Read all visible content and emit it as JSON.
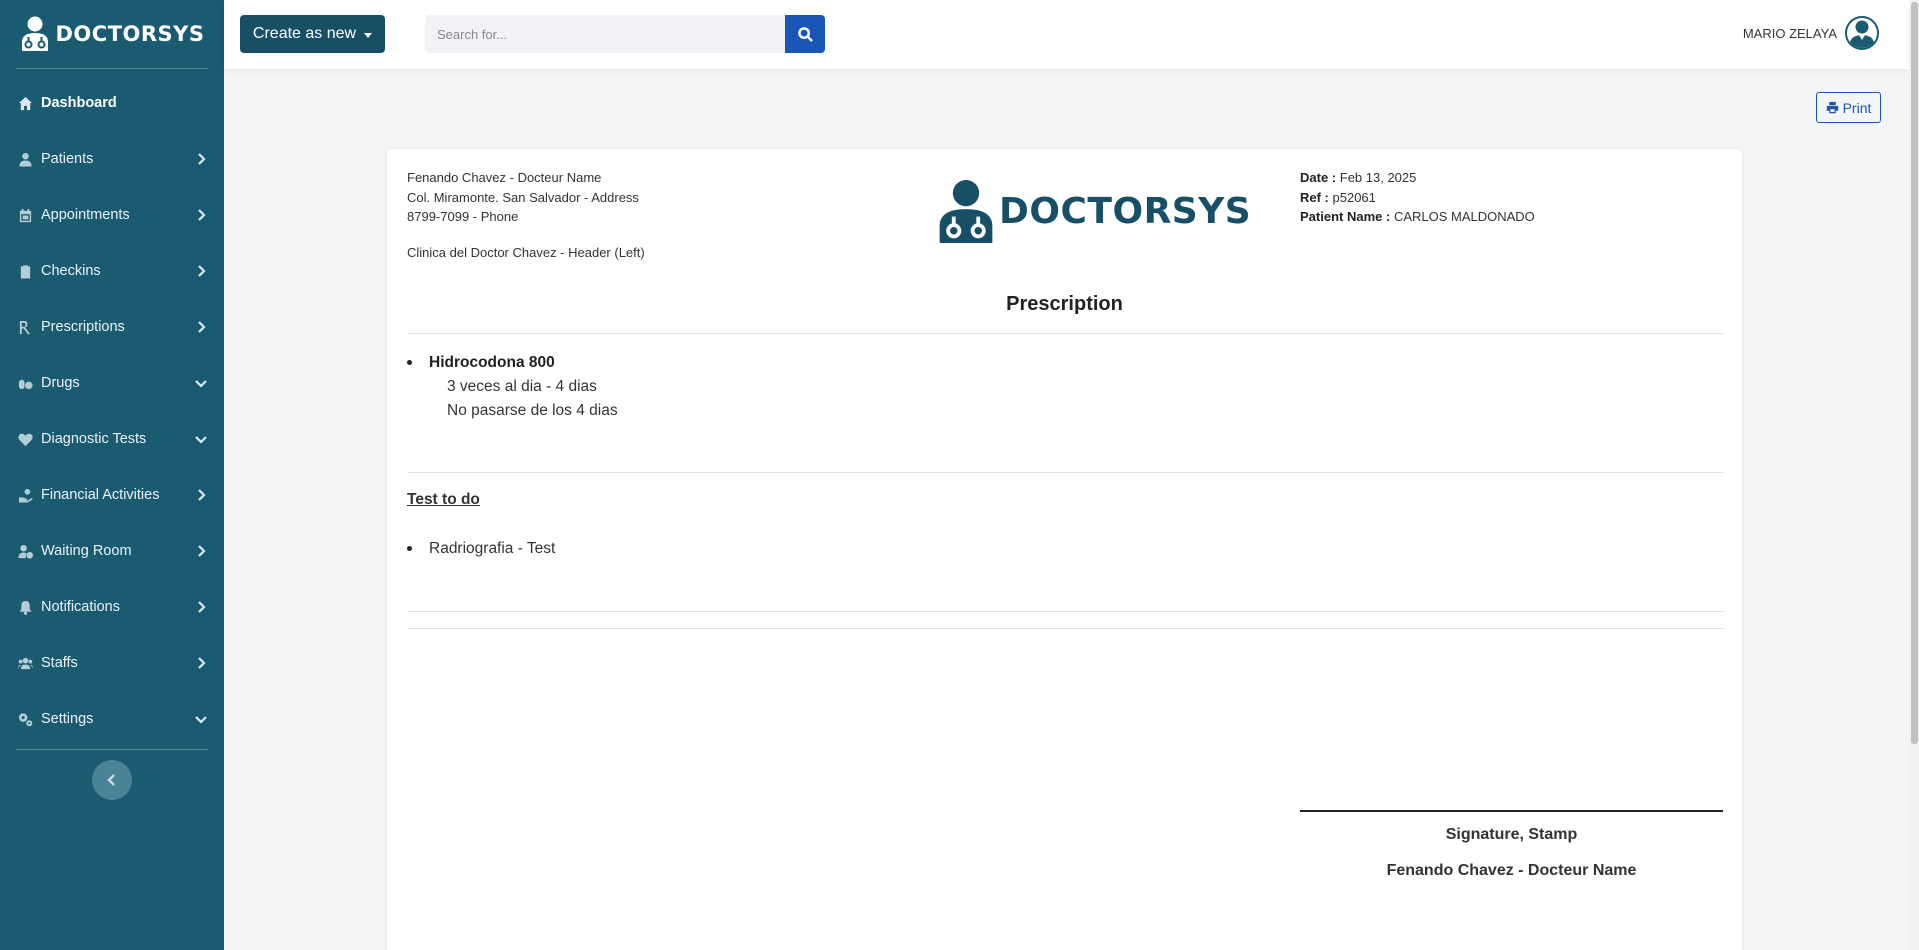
{
  "brand": {
    "name": "DOCTORSYS",
    "logo_icon": "doctor-icon"
  },
  "sidebar": {
    "items": [
      {
        "label": "Dashboard",
        "icon": "home-icon",
        "active": true,
        "chevron": "none"
      },
      {
        "label": "Patients",
        "icon": "user-icon",
        "chevron": "right"
      },
      {
        "label": "Appointments",
        "icon": "calendar-icon",
        "chevron": "right"
      },
      {
        "label": "Checkins",
        "icon": "clipboard-icon",
        "chevron": "right"
      },
      {
        "label": "Prescriptions",
        "icon": "prescription-icon",
        "chevron": "right"
      },
      {
        "label": "Drugs",
        "icon": "pills-icon",
        "chevron": "down"
      },
      {
        "label": "Diagnostic Tests",
        "icon": "heartbeat-icon",
        "chevron": "down"
      },
      {
        "label": "Financial Activities",
        "icon": "hand-money-icon",
        "chevron": "right"
      },
      {
        "label": "Waiting Room",
        "icon": "user-clock-icon",
        "chevron": "right"
      },
      {
        "label": "Notifications",
        "icon": "bell-icon",
        "chevron": "right"
      },
      {
        "label": "Staffs",
        "icon": "users-icon",
        "chevron": "right"
      },
      {
        "label": "Settings",
        "icon": "cogs-icon",
        "chevron": "down"
      }
    ],
    "collapse_icon": "chevron-left-icon"
  },
  "topbar": {
    "create_label": "Create as new",
    "search_placeholder": "Search for...",
    "search_icon": "search-icon",
    "user_name": "MARIO ZELAYA"
  },
  "print_label": "Print",
  "document": {
    "doctor_name": "Fenando Chavez - Docteur Name",
    "address": "Col. Miramonte. San Salvador - Address",
    "phone": "8799-7099 - Phone",
    "header_left": "Clinica del Doctor Chavez - Header (Left)",
    "logo_text": "DOCTORSYS",
    "date_label": "Date :",
    "date_value": "Feb 13, 2025",
    "ref_label": "Ref :",
    "ref_value": "p52061",
    "patient_label": "Patient Name :",
    "patient_value": "CARLOS MALDONADO",
    "title": "Prescription",
    "drugs": [
      {
        "name": "Hidrocodona 800",
        "dosage": "3 veces al dia - 4 dias",
        "note": "No pasarse de los 4 dias"
      }
    ],
    "tests_title": "Test to do",
    "tests": [
      "Radriografia - Test"
    ],
    "signature_label": "Signature, Stamp",
    "signature_name": "Fenando Chavez - Docteur Name"
  }
}
